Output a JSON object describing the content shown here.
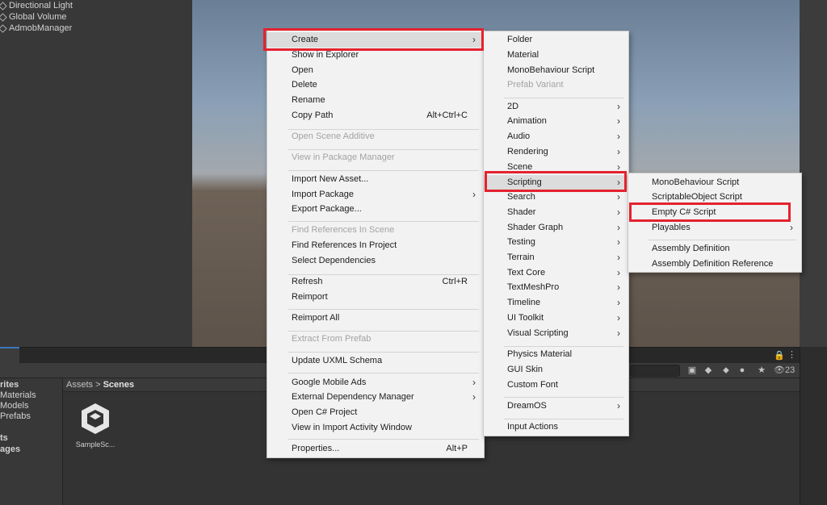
{
  "hierarchy": {
    "items": [
      "Directional Light",
      "Global Volume",
      "AdmobManager"
    ]
  },
  "project": {
    "breadcrumb_root": "Assets",
    "breadcrumb_sep": ">",
    "breadcrumb_current": "Scenes",
    "tree": [
      "rites",
      "Materials",
      "Models",
      "Prefabs",
      "ts",
      "ages"
    ],
    "asset_label": "SampleSc...",
    "hidden_count": "23",
    "lock_icon": "🔒",
    "kebab_icon": "⋮"
  },
  "menu_main": {
    "items": [
      {
        "label": "Create",
        "arrow": "›",
        "disabled": false
      },
      {
        "label": "Show in Explorer",
        "disabled": false
      },
      {
        "label": "Open",
        "disabled": false
      },
      {
        "label": "Delete",
        "disabled": false
      },
      {
        "label": "Rename",
        "disabled": false
      },
      {
        "label": "Copy Path",
        "shortcut": "Alt+Ctrl+C",
        "disabled": false
      },
      {
        "label": "Open Scene Additive",
        "disabled": true
      },
      {
        "label": "View in Package Manager",
        "disabled": true
      },
      {
        "label": "Import New Asset...",
        "disabled": false
      },
      {
        "label": "Import Package",
        "arrow": "›",
        "disabled": false
      },
      {
        "label": "Export Package...",
        "disabled": false
      },
      {
        "label": "Find References In Scene",
        "disabled": true
      },
      {
        "label": "Find References In Project",
        "disabled": false
      },
      {
        "label": "Select Dependencies",
        "disabled": false
      },
      {
        "label": "Refresh",
        "shortcut": "Ctrl+R",
        "disabled": false
      },
      {
        "label": "Reimport",
        "disabled": false
      },
      {
        "label": "Reimport All",
        "disabled": false
      },
      {
        "label": "Extract From Prefab",
        "disabled": true
      },
      {
        "label": "Update UXML Schema",
        "disabled": false
      },
      {
        "label": "Google Mobile Ads",
        "arrow": "›",
        "disabled": false
      },
      {
        "label": "External Dependency Manager",
        "arrow": "›",
        "disabled": false
      },
      {
        "label": "Open C# Project",
        "disabled": false
      },
      {
        "label": "View in Import Activity Window",
        "disabled": false
      },
      {
        "label": "Properties...",
        "shortcut": "Alt+P",
        "disabled": false
      }
    ]
  },
  "menu_create": {
    "items": [
      {
        "label": "Folder",
        "disabled": false
      },
      {
        "label": "Material",
        "disabled": false
      },
      {
        "label": "MonoBehaviour Script",
        "disabled": false
      },
      {
        "label": "Prefab Variant",
        "disabled": true
      },
      {
        "label": "2D",
        "arrow": "›"
      },
      {
        "label": "Animation",
        "arrow": "›"
      },
      {
        "label": "Audio",
        "arrow": "›"
      },
      {
        "label": "Rendering",
        "arrow": "›"
      },
      {
        "label": "Scene",
        "arrow": "›"
      },
      {
        "label": "Scripting",
        "arrow": "›"
      },
      {
        "label": "Search",
        "arrow": "›"
      },
      {
        "label": "Shader",
        "arrow": "›"
      },
      {
        "label": "Shader Graph",
        "arrow": "›"
      },
      {
        "label": "Testing",
        "arrow": "›"
      },
      {
        "label": "Terrain",
        "arrow": "›"
      },
      {
        "label": "Text Core",
        "arrow": "›"
      },
      {
        "label": "TextMeshPro",
        "arrow": "›"
      },
      {
        "label": "Timeline",
        "arrow": "›"
      },
      {
        "label": "UI Toolkit",
        "arrow": "›"
      },
      {
        "label": "Visual Scripting",
        "arrow": "›"
      },
      {
        "label": "Physics Material"
      },
      {
        "label": "GUI Skin"
      },
      {
        "label": "Custom Font"
      },
      {
        "label": "DreamOS",
        "arrow": "›"
      },
      {
        "label": "Input Actions"
      }
    ]
  },
  "menu_scripting": {
    "items": [
      {
        "label": "MonoBehaviour Script"
      },
      {
        "label": "ScriptableObject Script"
      },
      {
        "label": "Empty C# Script"
      },
      {
        "label": "Playables",
        "arrow": "›"
      },
      {
        "label": "Assembly Definition"
      },
      {
        "label": "Assembly Definition Reference"
      }
    ]
  },
  "colors": {
    "highlight_border": "#e4222e",
    "menu_bg": "#f2f2f2",
    "editor_bg": "#383838"
  }
}
